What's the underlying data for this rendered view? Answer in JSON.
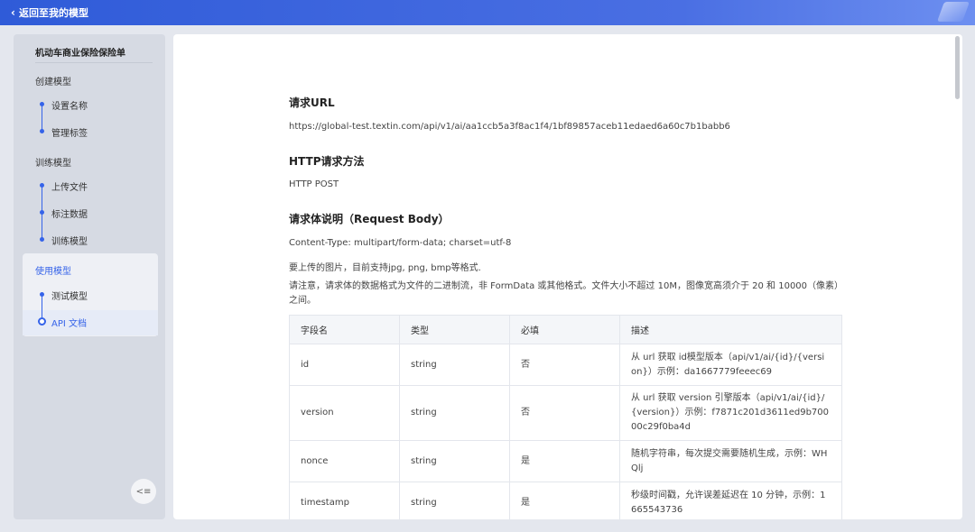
{
  "header": {
    "back_label": "返回至我的模型"
  },
  "sidebar": {
    "title": "机动车商业保险保险单",
    "groups": [
      {
        "label": "创建模型",
        "items": [
          "设置名称",
          "管理标签"
        ]
      },
      {
        "label": "训练模型",
        "items": [
          "上传文件",
          "标注数据",
          "训练模型"
        ]
      },
      {
        "label": "使用模型",
        "items": [
          "测试模型",
          "API 文档"
        ]
      }
    ],
    "current_item": "API 文档",
    "collapse_icon": "collapse-left-icon"
  },
  "doc": {
    "url_heading": "请求URL",
    "url": "https://global-test.textin.com/api/v1/ai/aa1ccb5a3f8ac1f4/1bf89857aceb11edaed6a60c7b1babb6",
    "method_heading": "HTTP请求方法",
    "method": "HTTP POST",
    "body_heading": "请求体说明（Request Body）",
    "content_type": "Content-Type: multipart/form-data; charset=utf-8",
    "upload_note": "要上传的图片，目前支持jpg, png, bmp等格式.",
    "format_note": "请注意，请求体的数据格式为文件的二进制流，非 FormData 或其他格式。文件大小不超过 10M，图像宽高须介于 20 和 10000（像素）之间。",
    "table": {
      "headers": [
        "字段名",
        "类型",
        "必填",
        "描述"
      ],
      "rows": [
        [
          "id",
          "string",
          "否",
          "从 url 获取 id模型版本（api/v1/ai/{id}/{version}）示例：da1667779feeec69"
        ],
        [
          "version",
          "string",
          "否",
          "从 url 获取 version 引擎版本（api/v1/ai/{id}/{version}）示例：f7871c201d3611ed9b70000c29f0ba4d"
        ],
        [
          "nonce",
          "string",
          "是",
          "随机字符串，每次提交需要随机生成，示例：WHQlj"
        ],
        [
          "timestamp",
          "string",
          "是",
          "秒级时间戳，允许误差延迟在 10 分钟，示例：1665543736"
        ]
      ]
    }
  }
}
